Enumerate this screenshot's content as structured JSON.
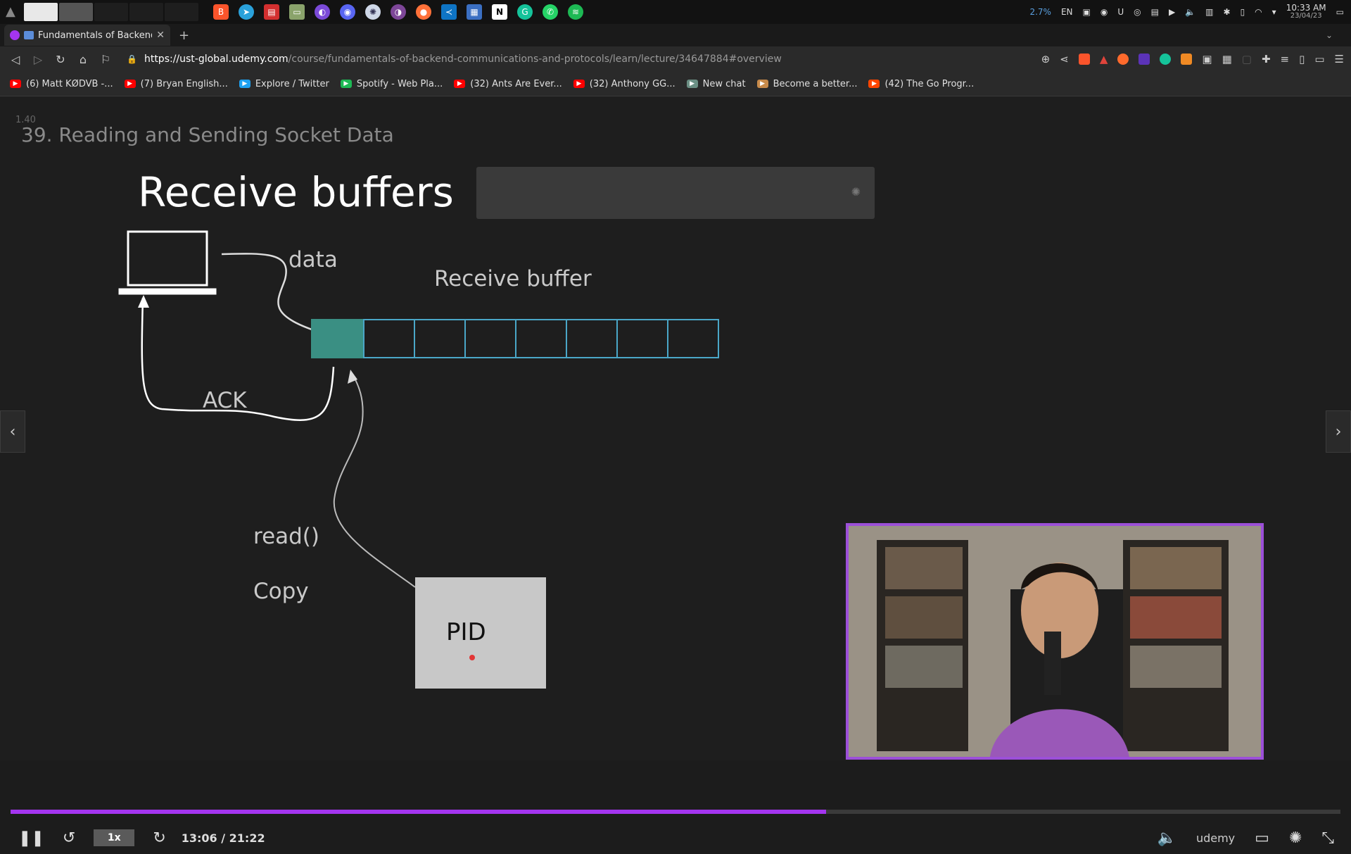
{
  "taskbar": {
    "tray_battery": "2.7%",
    "tray_lang": "EN",
    "clock_time": "10:33 AM",
    "clock_date": "23/04/23"
  },
  "browser": {
    "tab_title": "Fundamentals of Backend E",
    "url_host": "https://ust-global.udemy.com",
    "url_path": "/course/fundamentals-of-backend-communications-and-protocols/learn/lecture/34647884#overview",
    "bookmarks": [
      {
        "label": "(6) Matt KØDVB -...",
        "color": "#ff0000"
      },
      {
        "label": "(7) Bryan English...",
        "color": "#ff0000"
      },
      {
        "label": "Explore / Twitter",
        "color": "#1da1f2"
      },
      {
        "label": "Spotify - Web Pla...",
        "color": "#1db954"
      },
      {
        "label": "(32) Ants Are Ever...",
        "color": "#ff0000"
      },
      {
        "label": "(32) Anthony GG...",
        "color": "#ff0000"
      },
      {
        "label": "New chat",
        "color": "#6b8f84"
      },
      {
        "label": "Become a better...",
        "color": "#c78a4a"
      },
      {
        "label": "(42) The Go Progr...",
        "color": "#ff4500"
      }
    ]
  },
  "video": {
    "speed_overlay": "1.40",
    "lecture_title": "39. Reading and Sending Socket Data",
    "slide": {
      "title": "Receive buffers",
      "label_data": "data",
      "label_buffer": "Receive buffer",
      "label_ack": "ACK",
      "label_read": "read()",
      "label_copy": "Copy",
      "label_pid": "PID"
    },
    "controls": {
      "speed": "1x",
      "time": "13:06 / 21:22",
      "progress_fraction": 0.613,
      "brand": "udemy"
    }
  }
}
